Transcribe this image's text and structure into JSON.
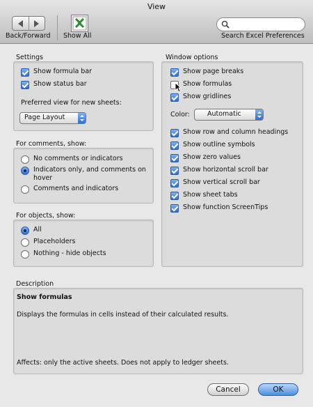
{
  "window": {
    "title": "View"
  },
  "toolbar": {
    "back_forward_label": "Back/Forward",
    "show_all_label": "Show All",
    "search_placeholder": "",
    "search_label": "Search Excel Preferences"
  },
  "settings": {
    "label": "Settings",
    "show_formula_bar": "Show formula bar",
    "show_status_bar": "Show status bar",
    "preferred_view_label": "Preferred view for new sheets:",
    "preferred_view_value": "Page Layout"
  },
  "comments": {
    "label": "For comments, show:",
    "options": [
      "No comments or indicators",
      "Indicators only, and comments on",
      "hover",
      "Comments and indicators"
    ],
    "selected_index": 1
  },
  "objects": {
    "label": "For objects, show:",
    "options": [
      "All",
      "Placeholders",
      "Nothing - hide objects"
    ],
    "selected_index": 0
  },
  "window_options": {
    "label": "Window options",
    "items": [
      {
        "label": "Show page breaks",
        "checked": true
      },
      {
        "label": "Show formulas",
        "checked": false
      },
      {
        "label": "Show gridlines",
        "checked": true
      }
    ],
    "color_label": "Color:",
    "color_value": "Automatic",
    "items2": [
      {
        "label": "Show row and column headings",
        "checked": true
      },
      {
        "label": "Show outline symbols",
        "checked": true
      },
      {
        "label": "Show zero values",
        "checked": true
      },
      {
        "label": "Show horizontal scroll bar",
        "checked": true
      },
      {
        "label": "Show vertical scroll bar",
        "checked": true
      },
      {
        "label": "Show sheet tabs",
        "checked": true
      },
      {
        "label": "Show function ScreenTips",
        "checked": true
      }
    ]
  },
  "description": {
    "label": "Description",
    "title": "Show formulas",
    "text": "Displays the formulas in cells instead of their calculated results.",
    "affects": "Affects: only the active sheets. Does not apply to ledger sheets."
  },
  "buttons": {
    "cancel": "Cancel",
    "ok": "OK"
  },
  "colors": {
    "accent": "#2f6fcf",
    "panel": "#dcdcdc"
  }
}
